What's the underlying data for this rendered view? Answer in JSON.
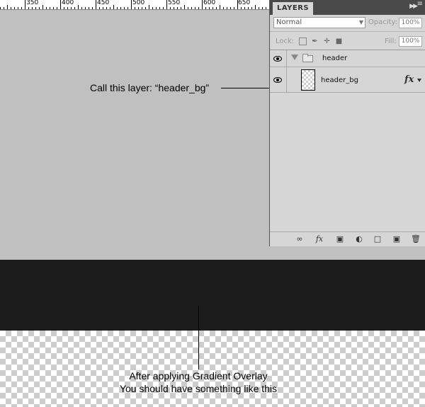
{
  "ruler": {
    "labels": [
      "350",
      "400",
      "450",
      "500",
      "550",
      "600",
      "650"
    ]
  },
  "annotations": {
    "layer_callout": "Call this layer: “header_bg”",
    "result_line1": "After applying Gradient Overlay",
    "result_line2": "You should have something like this"
  },
  "layers_panel": {
    "tab_label": "LAYERS",
    "blend_mode": "Normal",
    "opacity_label": "Opacity:",
    "opacity_value": "100%",
    "lock_label": "Lock:",
    "fill_label": "Fill:",
    "fill_value": "100%",
    "group_name": "header",
    "layer_name": "header_bg",
    "fx_label": "fx"
  },
  "colors": {
    "canvas_gray": "#c0c0c0",
    "header_bar": "#1c1c1c",
    "panel_bg": "#d6d6d6"
  }
}
